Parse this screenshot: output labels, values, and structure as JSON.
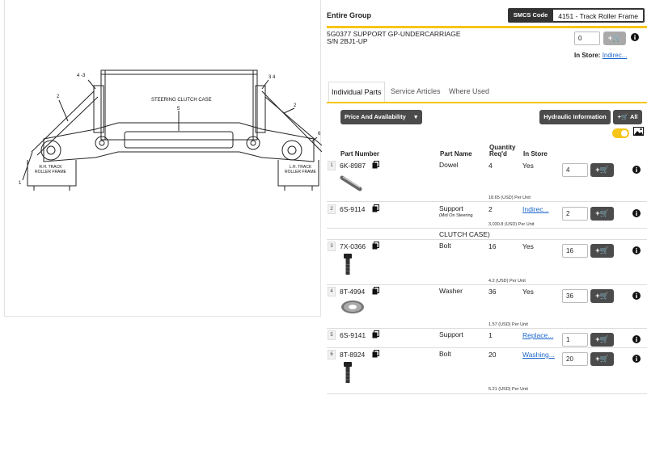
{
  "diagram": {
    "labels": {
      "callout_4_3": "4 -3",
      "callout_3_4": "3 4",
      "callout_2_left": "2",
      "callout_2_right": "2",
      "callout_5": "5",
      "callout_6": "6",
      "callout_1": "1",
      "steering_clutch_case": "STEERING CLUTCH CASE",
      "rh_track_line1": "R.H. TRACK",
      "rh_track_line2": "ROLLER FRAME",
      "lh_track_line1": "L.H. TRACK",
      "lh_track_line2": "ROLLER FRAME"
    }
  },
  "header": {
    "title": "Entire Group",
    "smcs_label": "SMCS Code",
    "smcs_value": "4151 - Track Roller Frame"
  },
  "assembly": {
    "title_line1": "5G0377 SUPPORT GP-UNDERCARRIAGE",
    "title_line2": "S/N 2BJ1-UP",
    "qty": "0",
    "cart_label": "+🛒",
    "in_store_label": "In Store:",
    "in_store_value": "Indirec..."
  },
  "tabs": [
    {
      "label": "Individual Parts",
      "active": true
    },
    {
      "label": "Service Articles",
      "active": false
    },
    {
      "label": "Where Used",
      "active": false
    }
  ],
  "toolbar": {
    "price_availability": "Price And Availability",
    "hydraulic_info": "Hydraulic Information",
    "add_all": "All",
    "cart_glyph": "+🛒"
  },
  "columns": {
    "part_number": "Part Number",
    "part_name": "Part Name",
    "quantity_line1": "Quantity",
    "quantity_line2": "Req'd",
    "in_store": "In Store"
  },
  "rows": [
    {
      "num": "1",
      "part_number": "6K-8987",
      "part_name": "Dowel",
      "sub": "",
      "qty": "4",
      "in_store": "Yes",
      "in_store_link": false,
      "input_qty": "4",
      "price": "18.65 (USD) Per Unit",
      "thumb": "dowel-icon"
    },
    {
      "num": "2",
      "part_number": "6S-9114",
      "part_name": "Support",
      "sub": "(Mid On Steering",
      "qty": "2",
      "in_store": "Indirec...",
      "in_store_link": true,
      "input_qty": "2",
      "price": "3,030.8 (USD) Per Unit",
      "thumb": ""
    },
    {
      "num": "3",
      "part_number": "7X-0366",
      "part_name": "Bolt",
      "sub": "",
      "qty": "16",
      "in_store": "Yes",
      "in_store_link": false,
      "input_qty": "16",
      "price": "4.2 (USD) Per Unit",
      "thumb": "bolt-icon"
    },
    {
      "num": "4",
      "part_number": "8T-4994",
      "part_name": "Washer",
      "sub": "",
      "qty": "36",
      "in_store": "Yes",
      "in_store_link": false,
      "input_qty": "36",
      "price": "1.57 (USD) Per Unit",
      "thumb": "washer-icon"
    },
    {
      "num": "5",
      "part_number": "6S-9141",
      "part_name": "Support",
      "sub": "",
      "qty": "1",
      "in_store": "Replace...",
      "in_store_link": true,
      "input_qty": "1",
      "price": "",
      "thumb": ""
    },
    {
      "num": "6",
      "part_number": "8T-8924",
      "part_name": "Bolt",
      "sub": "",
      "qty": "20",
      "in_store": "Washing...",
      "in_store_link": true,
      "input_qty": "20",
      "price": "5.21 (USD) Per Unit",
      "thumb": "bolt-icon"
    }
  ],
  "group_label": "CLUTCH CASE)",
  "colors": {
    "accent_yellow": "#f5c518",
    "button_dark": "#4b4b4b",
    "link_blue": "#1a66cc"
  }
}
